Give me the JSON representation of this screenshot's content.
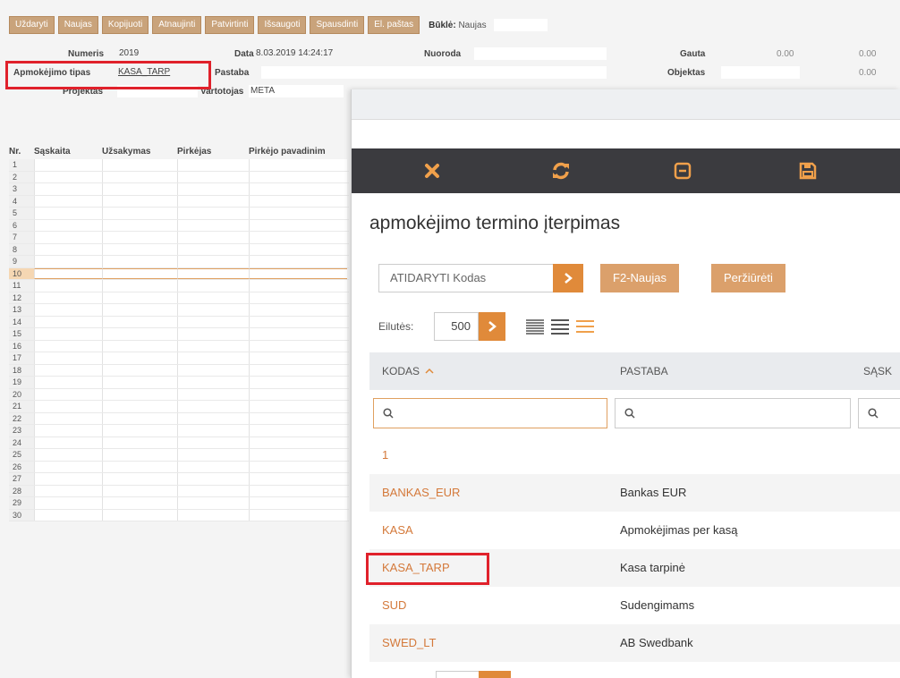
{
  "toolbar": {
    "buttons": [
      "Uždaryti",
      "Naujas",
      "Kopijuoti",
      "Atnaujinti",
      "Patvirtinti",
      "Išsaugoti",
      "Spausdinti",
      "El. paštas"
    ],
    "status_label": "Būklė:",
    "status_value": "Naujas"
  },
  "form": {
    "numeris_label": "Numeris",
    "numeris_value": "2019",
    "data_label": "Data",
    "data_value": "8.03.2019 14:24:17",
    "nuoroda_label": "Nuoroda",
    "nuoroda_value": "",
    "gauta_label": "Gauta",
    "gauta_value1": "0.00",
    "gauta_value2": "0.00",
    "apmokejimo_label": "Apmokėjimo tipas",
    "apmokejimo_value": "KASA_TARP",
    "pastaba_label": "Pastaba",
    "pastaba_value": "",
    "objektas_label": "Objektas",
    "objektas_value": "",
    "objektas_num": "0.00",
    "projektas_label": "Projektas",
    "projektas_value": "",
    "vartotojas_label": "Vartotojas",
    "vartotojas_value": "META"
  },
  "grid": {
    "headers": [
      "Nr.",
      "Sąskaita",
      "Užsakymas",
      "Pirkėjas",
      "Pirkėjo pavadinim"
    ],
    "row_numbers": [
      "1",
      "2",
      "3",
      "4",
      "5",
      "6",
      "7",
      "8",
      "9",
      "10",
      "11",
      "12",
      "13",
      "14",
      "15",
      "16",
      "17",
      "18",
      "19",
      "20",
      "21",
      "22",
      "23",
      "24",
      "25",
      "26",
      "27",
      "28",
      "29",
      "30"
    ],
    "selected_row": "10"
  },
  "modal": {
    "title": "apmokėjimo termino įterpimas",
    "toolbar_icons": [
      "close-icon",
      "refresh-icon",
      "minimize-icon",
      "save-icon"
    ],
    "search_placeholder": "ATIDARYTI Kodas",
    "new_button": "F2-Naujas",
    "view_button": "Peržiūrėti",
    "rows_label": "Eilutės:",
    "rows_value": "500",
    "columns": [
      "KODAS",
      "PASTABA",
      "SĄSK"
    ],
    "rows": [
      {
        "kodas": "1",
        "pastaba": ""
      },
      {
        "kodas": "BANKAS_EUR",
        "pastaba": "Bankas EUR"
      },
      {
        "kodas": "KASA",
        "pastaba": "Apmokėjimas per kasą"
      },
      {
        "kodas": "KASA_TARP",
        "pastaba": "Kasa tarpinė"
      },
      {
        "kodas": "SUD",
        "pastaba": "Sudengimams"
      },
      {
        "kodas": "SWED_LT",
        "pastaba": "AB Swedbank"
      }
    ]
  },
  "colors": {
    "accent": "#e08a3a",
    "link": "#d4793a",
    "dark_bar": "#3b3b3f",
    "highlight": "#e0212b"
  }
}
